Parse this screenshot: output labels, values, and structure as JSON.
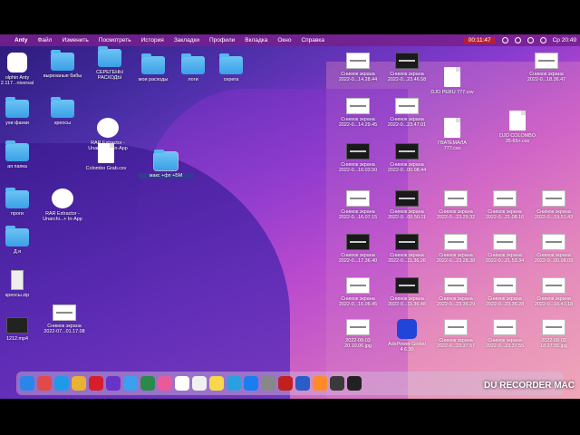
{
  "menubar": {
    "app": "Anty",
    "items": [
      "Файл",
      "Изменить",
      "Посмотреть",
      "История",
      "Закладки",
      "Профили",
      "Вкладка",
      "Окно",
      "Справка"
    ],
    "record_time": "00:11:47",
    "datetime": "Ср 20:49"
  },
  "desktop": {
    "items": [
      {
        "label": "olphin Anty\n2.117...niversal",
        "kind": "dolphin"
      },
      {
        "label": "вырезаные бабы",
        "kind": "folder"
      },
      {
        "label": "СЕРЕГЕНЫ\nРАСХОДЫ",
        "kind": "folder"
      },
      {
        "label": "мои расходы",
        "kind": "folder"
      },
      {
        "label": "логи",
        "kind": "folder"
      },
      {
        "label": "серега",
        "kind": "folder"
      },
      {
        "label": "ухи фанки",
        "kind": "folder"
      },
      {
        "label": "креосы",
        "kind": "folder"
      },
      {
        "label": "RAR Extractor -\nUnarchi...+ In-App",
        "kind": "rar"
      },
      {
        "label": "Colombo Grab.csv",
        "kind": "doc"
      },
      {
        "label": "макс +фп +БМ",
        "kind": "folder"
      },
      {
        "label": "ая папка",
        "kind": "folder"
      },
      {
        "label": "проги",
        "kind": "folder"
      },
      {
        "label": "RAR Extractor -\nUnarchi...+ In-App",
        "kind": "rar"
      },
      {
        "label": "Д.я",
        "kind": "folder"
      },
      {
        "label": "креосы.zip",
        "kind": "zip"
      },
      {
        "label": "Снимок экрана\n2022-07...01.17.08",
        "kind": "shot"
      },
      {
        "label": "1212.mp4",
        "kind": "video"
      },
      {
        "label": "Снимок экрана\n2022-0...14.28.44",
        "kind": "shot"
      },
      {
        "label": "Снимок экрана\n2022-0...23.46.58",
        "kind": "shot"
      },
      {
        "label": "DJO PERU 777.csv",
        "kind": "doc"
      },
      {
        "label": "Снимок экрана\n2022-0...18.36.47",
        "kind": "shot"
      },
      {
        "label": "Снимок экрана\n2022-0...14.29.45",
        "kind": "shot"
      },
      {
        "label": "Снимок экрана\n2022-0...23.47.01",
        "kind": "shot"
      },
      {
        "label": "ГВАТЕМАЛА\n777.csv",
        "kind": "doc"
      },
      {
        "label": "DJO COLOMBO\n35-65+.csv",
        "kind": "doc"
      },
      {
        "label": "Снимок экрана\n2022-0...16.03.50",
        "kind": "shot"
      },
      {
        "label": "Снимок экрана\n2022-0...00.08.44",
        "kind": "shot"
      },
      {
        "label": "Снимок экрана\n2022-0...16.07.15",
        "kind": "shot"
      },
      {
        "label": "Снимок экрана\n2022-0...00.50.11",
        "kind": "shot"
      },
      {
        "label": "Снимок экрана\n2022-0...23.29.32",
        "kind": "shot"
      },
      {
        "label": "Снимок экрана\n2022-0...21.08.16",
        "kind": "shot"
      },
      {
        "label": "Снимок экрана\n2022-0...19.51.43",
        "kind": "shot"
      },
      {
        "label": "Снимок экрана\n2022-0...17.36.40",
        "kind": "shot"
      },
      {
        "label": "Снимок экрана\n2022-0...11.36.26",
        "kind": "shot"
      },
      {
        "label": "Снимок экрана\n2022-0...23.28.38",
        "kind": "shot"
      },
      {
        "label": "Снимок экрана\n2022-0...21.53.34",
        "kind": "shot"
      },
      {
        "label": "Снимок экрана\n2022-0...00.08.09",
        "kind": "shot"
      },
      {
        "label": "Снимок экрана\n2022-0...16.06.45",
        "kind": "shot"
      },
      {
        "label": "Снимок экрана\n2022-0...11.36.48",
        "kind": "shot"
      },
      {
        "label": "Снимок экрана\n2022-0...23.36.29",
        "kind": "shot"
      },
      {
        "label": "Снимок экрана\n2022-0...23.36.28",
        "kind": "shot"
      },
      {
        "label": "Снимок экрана\n2022-0...16.41.18",
        "kind": "shot"
      },
      {
        "label": "2022-08-03\n20.10.06.jpg",
        "kind": "shot"
      },
      {
        "label": "AdsPower Global\n4.6.30",
        "kind": "app"
      },
      {
        "label": "Снимок экрана\n2022-0...23.37.57",
        "kind": "shot"
      },
      {
        "label": "Снимок экрана\n2022-0...23.37.55",
        "kind": "shot"
      },
      {
        "label": "2022-08-02\n18.27.55.jpg",
        "kind": "shot"
      }
    ]
  },
  "dock": {
    "apps": [
      "Finder",
      "Launchpad",
      "Safari",
      "Chrome",
      "Opera",
      "Dolphin",
      "Mail",
      "Maps",
      "Photos",
      "Calendar",
      "Reminders",
      "Notes",
      "Telegram",
      "App Store",
      "Settings",
      "Anty",
      "Word",
      "Camera",
      "L17",
      "Terminal"
    ],
    "colors": [
      "#2a86e8",
      "#e04a4a",
      "#1e9be8",
      "#e9b233",
      "#d81e2a",
      "#6a33c8",
      "#3aa0f0",
      "#2a8a4a",
      "#e85a9a",
      "#ffffff",
      "#f0f0f0",
      "#f6d94a",
      "#2aa0e0",
      "#1a7ef0",
      "#888888",
      "#c02020",
      "#2b5dc8",
      "#ff8a2a",
      "#3a3a3a",
      "#222222"
    ],
    "calendar_day": "3"
  },
  "watermark": "DU RECORDER MAC"
}
